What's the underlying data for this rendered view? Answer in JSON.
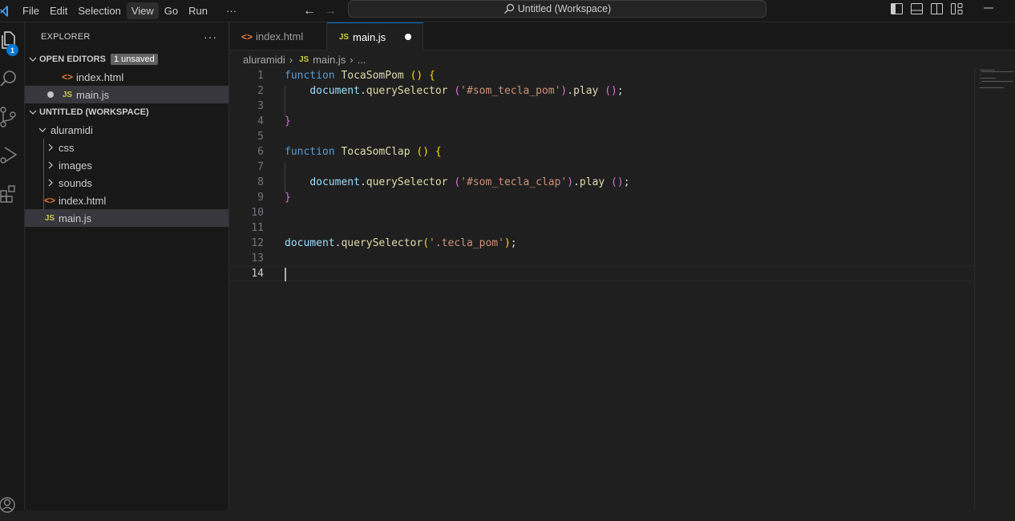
{
  "menu": [
    "File",
    "Edit",
    "Selection",
    "View",
    "Go",
    "Run",
    "···"
  ],
  "active_menu_index": 3,
  "command_center": {
    "label": "Untitled (Workspace)",
    "icon": "search-icon"
  },
  "navigation": {
    "back_icon": "arrow-left-icon",
    "forward_icon": "arrow-right-icon"
  },
  "layout_controls": [
    "toggle-primary-sidebar-icon",
    "toggle-panel-icon",
    "toggle-secondary-sidebar-icon",
    "customize-layout-icon",
    "minimize-icon"
  ],
  "activity_bar": {
    "items": [
      "explorer-icon",
      "search-icon",
      "source-control-icon",
      "run-debug-icon",
      "extensions-icon"
    ],
    "explorer_badge": "1",
    "bottom": [
      "accounts-icon"
    ]
  },
  "sidebar": {
    "title": "EXPLORER",
    "more": "···",
    "open_editors": {
      "title": "OPEN EDITORS",
      "badge": "1 unsaved",
      "items": [
        {
          "name": "index.html",
          "type": "html",
          "dirty": false
        },
        {
          "name": "main.js",
          "type": "js",
          "dirty": true
        }
      ]
    },
    "workspace": {
      "title": "UNTITLED (WORKSPACE)",
      "root": "aluramidi",
      "items": [
        {
          "name": "css",
          "type": "folder"
        },
        {
          "name": "images",
          "type": "folder"
        },
        {
          "name": "sounds",
          "type": "folder"
        },
        {
          "name": "index.html",
          "type": "html"
        },
        {
          "name": "main.js",
          "type": "js"
        }
      ]
    }
  },
  "tabs": [
    {
      "label": "index.html",
      "type": "html",
      "active": false
    },
    {
      "label": "main.js",
      "type": "js",
      "active": true,
      "dirty": true
    }
  ],
  "breadcrumb": [
    "aluramidi",
    "main.js",
    "..."
  ],
  "file_icons": {
    "html": "<>",
    "js": "JS"
  },
  "editor": {
    "current_line": 14,
    "lines": [
      "function TocaSomPom () {",
      "    document.querySelector ('#som_tecla_pom').play ();",
      "",
      "}",
      "",
      "function TocaSomClap () {",
      "",
      "    document.querySelector ('#som_tecla_clap').play ();",
      "}",
      "",
      "",
      "document.querySelector('.tecla_pom');",
      "",
      ""
    ]
  },
  "colors": {
    "accent": "#0078d4",
    "keyword": "#569cd6",
    "function": "#dcdcaa",
    "variable": "#9cdcfe",
    "string": "#ce9178",
    "bracket1": "#ffd700",
    "bracket2": "#da70d6"
  }
}
